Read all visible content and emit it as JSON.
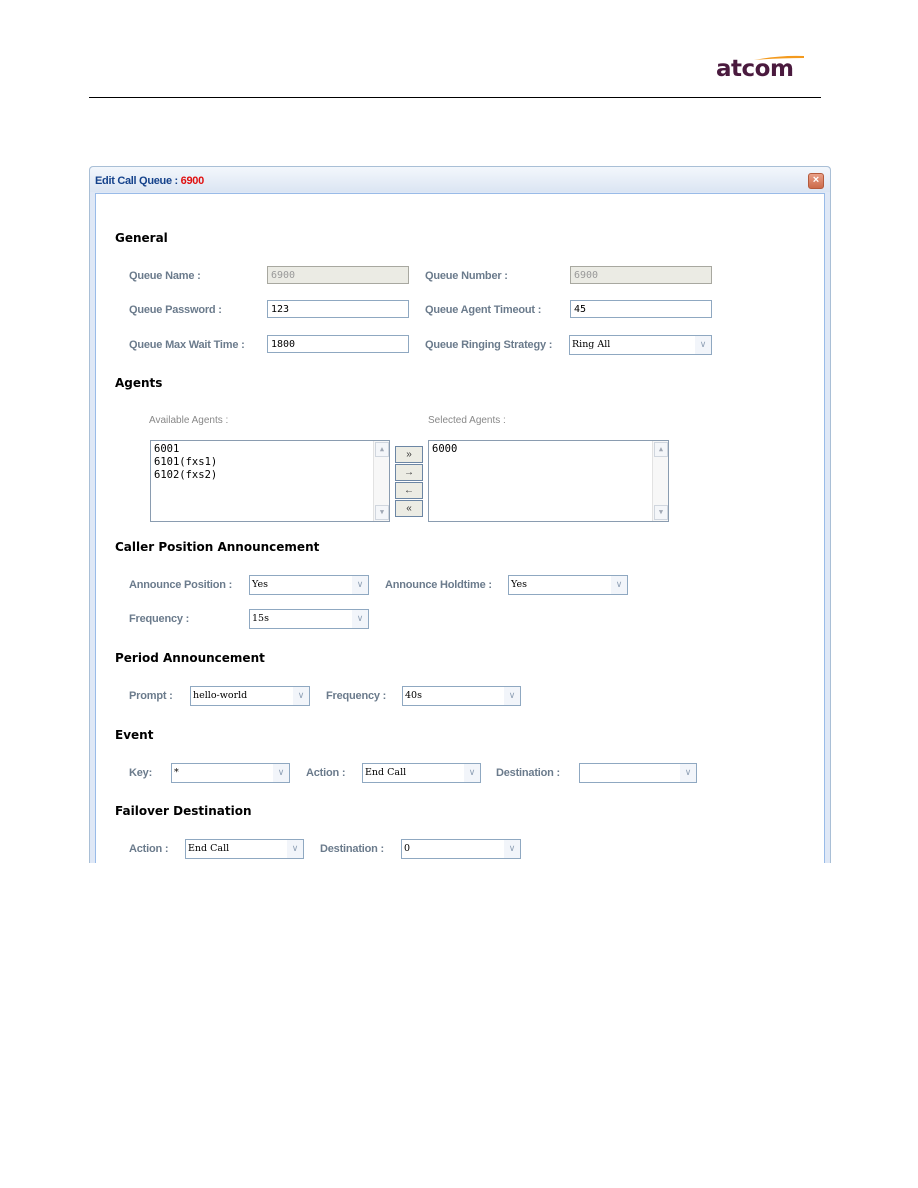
{
  "brand": {
    "logo_text": "atcom",
    "swoosh_color": "#f39a1e",
    "logo_color": "#4a1a3e"
  },
  "dialog": {
    "title_prefix": "Edit Call Queue : ",
    "title_queue": "6900",
    "close_icon": "close-icon"
  },
  "general": {
    "heading": "General",
    "queue_name_label": "Queue Name :",
    "queue_name_value": "6900",
    "queue_number_label": "Queue Number :",
    "queue_number_value": "6900",
    "queue_password_label": "Queue Password :",
    "queue_password_value": "123",
    "agent_timeout_label": "Queue Agent Timeout :",
    "agent_timeout_value": "45",
    "max_wait_label": "Queue Max Wait Time :",
    "max_wait_value": "1800",
    "ringing_strategy_label": "Queue Ringing Strategy :",
    "ringing_strategy_value": "Ring All"
  },
  "agents": {
    "heading": "Agents",
    "available_label": "Available Agents :",
    "selected_label": "Selected Agents :",
    "available": [
      "6001",
      "6101(fxs1)",
      "6102(fxs2)"
    ],
    "selected": [
      "6000"
    ],
    "buttons": {
      "add_all": "»",
      "add": "→",
      "remove": "←",
      "remove_all": "«"
    }
  },
  "caller_position": {
    "heading": "Caller Position Announcement",
    "announce_position_label": "Announce Position :",
    "announce_position_value": "Yes",
    "announce_holdtime_label": "Announce Holdtime :",
    "announce_holdtime_value": "Yes",
    "frequency_label": "Frequency :",
    "frequency_value": "15s"
  },
  "period": {
    "heading": "Period Announcement",
    "prompt_label": "Prompt :",
    "prompt_value": "hello-world",
    "frequency_label": "Frequency :",
    "frequency_value": "40s"
  },
  "event": {
    "heading": "Event",
    "key_label": "Key:",
    "key_value": "*",
    "action_label": "Action :",
    "action_value": "End Call",
    "destination_label": "Destination :",
    "destination_value": ""
  },
  "failover": {
    "heading": "Failover Destination",
    "action_label": "Action :",
    "action_value": "End Call",
    "destination_label": "Destination :",
    "destination_value": "0"
  },
  "dropdown_arrow": "∨"
}
